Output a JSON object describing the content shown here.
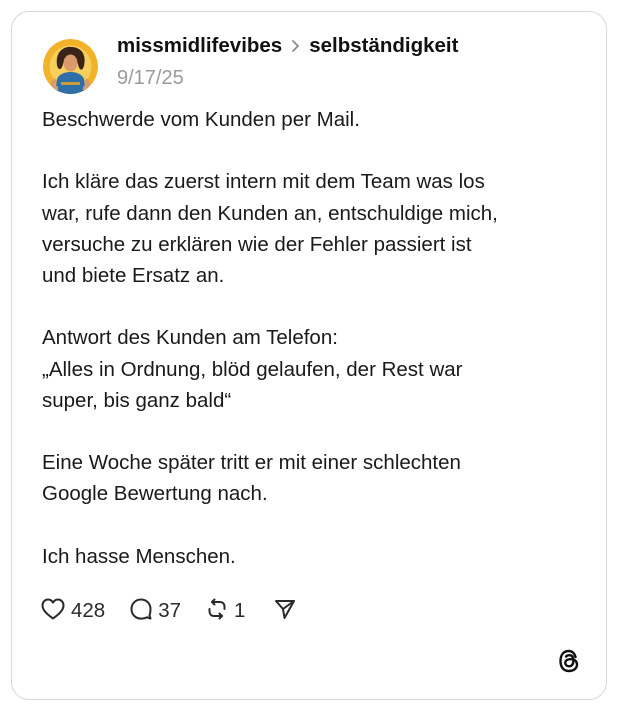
{
  "post": {
    "username": "missmidlifevibes",
    "topic": "selbständigkeit",
    "date": "9/17/25",
    "text": "Beschwerde vom Kunden per Mail.\n\nIch kläre das zuerst intern mit dem Team was los\nwar, rufe dann den Kunden an, entschuldige mich,\nversuche zu  erklären wie der Fehler passiert ist\nund biete Ersatz an.\n\nAntwort des Kunden am Telefon:\n„Alles in Ordnung, blöd gelaufen, der Rest war\nsuper, bis ganz bald“\n\nEine Woche später tritt er mit einer schlechten\nGoogle Bewertung nach.\n\nIch hasse Menschen."
  },
  "actions": {
    "likes": "428",
    "replies": "37",
    "reposts": "1"
  },
  "icons": {
    "like": "heart-icon",
    "reply": "speech-bubble-icon",
    "repost": "repost-arrows-icon",
    "share": "send-paper-plane-icon",
    "chevron": "chevron-right-icon",
    "brand": "threads-logo-icon"
  },
  "colors": {
    "text": "#1a1a1a",
    "muted": "#9a9a9a",
    "border": "#d9d9d9"
  }
}
